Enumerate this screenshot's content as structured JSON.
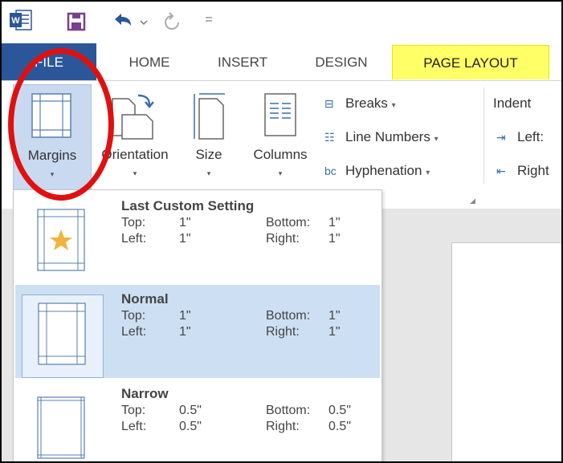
{
  "qat": {
    "word_icon": "word-logo-icon",
    "save_icon": "save-icon",
    "undo_icon": "undo-icon",
    "redo_icon": "redo-icon",
    "customize_glyph": "="
  },
  "tabs": {
    "file": "FILE",
    "home": "HOME",
    "insert": "INSERT",
    "design": "DESIGN",
    "page_layout": "PAGE LAYOUT",
    "highlight_color": "#ffff66"
  },
  "ribbon": {
    "margins": "Margins",
    "orientation": "Orientation",
    "size": "Size",
    "columns": "Columns",
    "breaks": "Breaks",
    "line_numbers": "Line Numbers",
    "hyphenation": "Hyphenation",
    "indent": "Indent",
    "indent_left": "Left:",
    "indent_right": "Right",
    "dropdown_arrow": "▾"
  },
  "margins_menu": [
    {
      "name": "Last Custom Setting",
      "top_label": "Top:",
      "top": "1\"",
      "bottom_label": "Bottom:",
      "bottom": "1\"",
      "left_label": "Left:",
      "left": "1\"",
      "right_label": "Right:",
      "right": "1\""
    },
    {
      "name": "Normal",
      "top_label": "Top:",
      "top": "1\"",
      "bottom_label": "Bottom:",
      "bottom": "1\"",
      "left_label": "Left:",
      "left": "1\"",
      "right_label": "Right:",
      "right": "1\""
    },
    {
      "name": "Narrow",
      "top_label": "Top:",
      "top": "0.5\"",
      "bottom_label": "Bottom:",
      "bottom": "0.5\"",
      "left_label": "Left:",
      "left": "0.5\"",
      "right_label": "Right:",
      "right": "0.5\""
    }
  ],
  "colors": {
    "file_tab": "#2b579a",
    "selected_option": "#cddff2",
    "annotation_circle": "#e01010"
  }
}
